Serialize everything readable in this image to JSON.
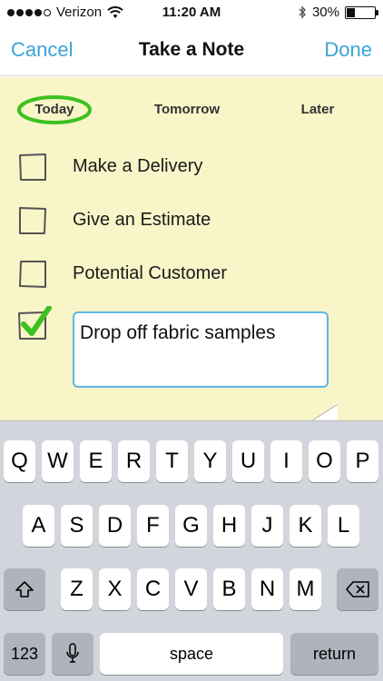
{
  "status_bar": {
    "carrier": "Verizon",
    "time": "11:20 AM",
    "battery_percent": "30%",
    "battery_level": 0.3
  },
  "nav": {
    "cancel_label": "Cancel",
    "title": "Take a Note",
    "done_label": "Done"
  },
  "tabs": {
    "today": "Today",
    "tomorrow": "Tomorrow",
    "later": "Later",
    "selected": "Today"
  },
  "tasks": [
    {
      "label": "Make a Delivery",
      "checked": false
    },
    {
      "label": "Give an Estimate",
      "checked": false
    },
    {
      "label": "Potential Customer",
      "checked": false
    },
    {
      "label": "Drop off fabric samples",
      "checked": true,
      "editing": true
    }
  ],
  "colors": {
    "accent": "#3aa3d8",
    "note_background": "#f8f5c8",
    "check_green": "#3cc11e",
    "keyboard_background": "#d2d5db"
  },
  "keyboard": {
    "row1": [
      "Q",
      "W",
      "E",
      "R",
      "T",
      "Y",
      "U",
      "I",
      "O",
      "P"
    ],
    "row2": [
      "A",
      "S",
      "D",
      "F",
      "G",
      "H",
      "J",
      "K",
      "L"
    ],
    "row3": [
      "Z",
      "X",
      "C",
      "V",
      "B",
      "N",
      "M"
    ],
    "shift_icon": "shift-icon",
    "delete_icon": "backspace-icon",
    "numbers_label": "123",
    "mic_icon": "microphone-icon",
    "space_label": "space",
    "return_label": "return"
  }
}
